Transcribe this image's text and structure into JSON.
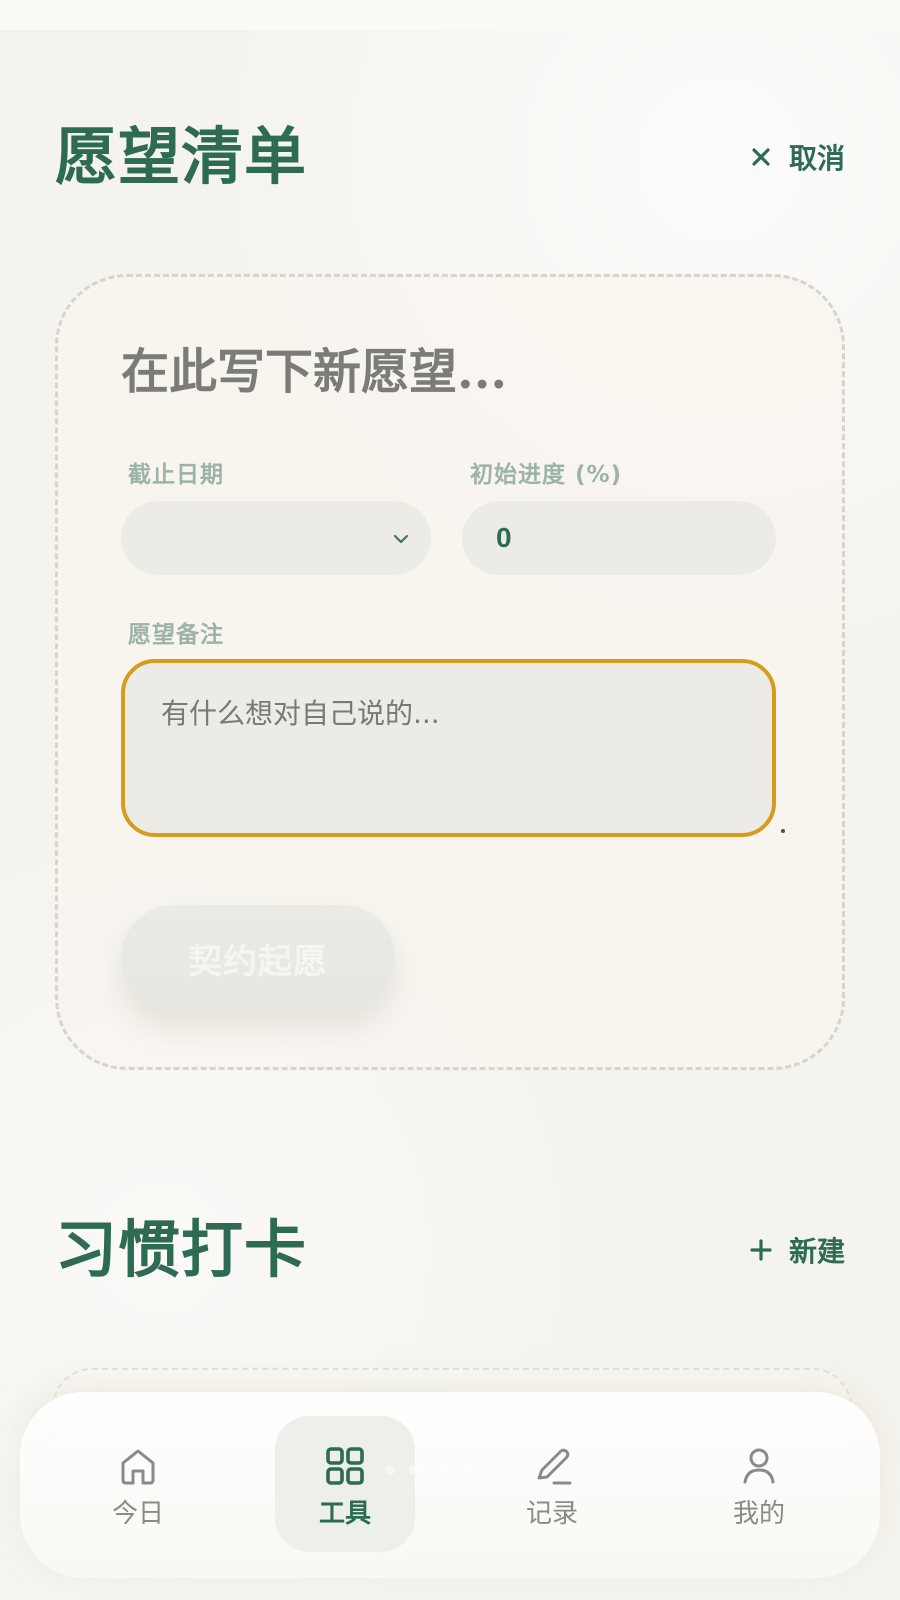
{
  "colors": {
    "background": "#f5f3ee",
    "brand_green": "#2d6b52",
    "muted_label": "#9db3a7",
    "field_bg": "#ecebe6",
    "focus_border": "#d59c1d",
    "nav_inactive": "#8a8a86"
  },
  "wish_section": {
    "title": "愿望清单",
    "cancel_label": "取消",
    "cancel_icon": "close-icon",
    "form": {
      "wish_placeholder": "在此写下新愿望...",
      "deadline_label": "截止日期",
      "deadline_value": "",
      "deadline_icon": "chevron-down-icon",
      "progress_label": "初始进度 (%)",
      "progress_value": "0",
      "notes_label": "愿望备注",
      "notes_placeholder": "有什么想对自己说的...",
      "submit_label": "契约起愿"
    }
  },
  "habit_section": {
    "title": "习惯打卡",
    "new_label": "新建",
    "new_icon": "plus-icon"
  },
  "bottom_nav": {
    "items": [
      {
        "label": "今日",
        "icon": "home-icon",
        "active": false
      },
      {
        "label": "工具",
        "icon": "grid-icon",
        "active": true
      },
      {
        "label": "记录",
        "icon": "pencil-icon",
        "active": false
      },
      {
        "label": "我的",
        "icon": "user-icon",
        "active": false
      }
    ]
  }
}
